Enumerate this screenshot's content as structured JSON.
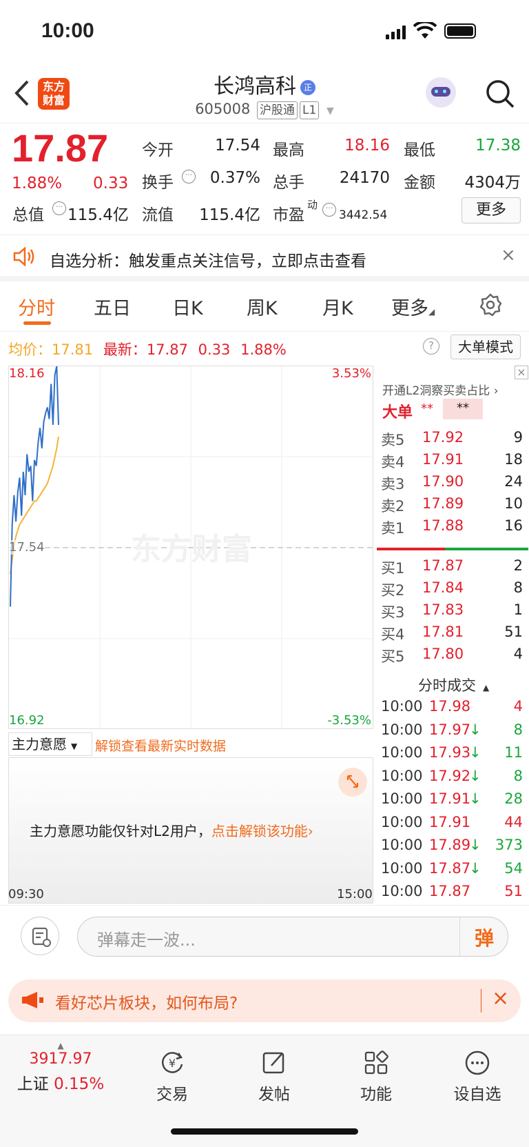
{
  "status_bar": {
    "time": "10:00"
  },
  "header": {
    "logo_line1": "东方",
    "logo_line2": "财富",
    "stock_name": "长鸿高科",
    "badge": "正",
    "code": "605008",
    "tag1": "沪股通",
    "tag2": "L1"
  },
  "quote": {
    "price": "17.87",
    "change_pct": "1.88%",
    "change": "0.33",
    "open_label": "今开",
    "open": "17.54",
    "high_label": "最高",
    "high": "18.16",
    "low_label": "最低",
    "low": "17.38",
    "turnover_label": "换手",
    "turnover": "0.37%",
    "volume_label": "总手",
    "volume": "24170",
    "amount_label": "金额",
    "amount": "4304万",
    "mktcap_label": "总值",
    "mktcap": "115.4亿",
    "float_label": "流值",
    "float": "115.4亿",
    "pe_label": "市盈",
    "pe_sup": "动",
    "pe": "3442.54",
    "more_button": "更多"
  },
  "notice": {
    "text": "自选分析：触发重点关注信号，立即点击查看"
  },
  "tabs": [
    "分时",
    "五日",
    "日K",
    "周K",
    "月K",
    "更多"
  ],
  "info_line": {
    "avg_label": "均价：",
    "avg": "17.81",
    "latest_label": "最新：",
    "latest": "17.87",
    "chg": "0.33",
    "pct": "1.88%",
    "mode_button": "大单模式"
  },
  "chart": {
    "y_top": "18.16",
    "y_mid": "17.54",
    "y_bottom": "16.92",
    "pct_top": "3.53%",
    "pct_bottom": "-3.53%",
    "x_start": "09:30",
    "x_end": "15:00",
    "watermark": "东方财富"
  },
  "chart_data": {
    "type": "line",
    "ylim": [
      16.92,
      18.16
    ],
    "reference": 17.54,
    "series": [
      {
        "values": [
          17.34,
          17.62,
          17.72,
          17.63,
          17.73,
          17.78,
          17.65,
          17.8,
          17.72,
          17.86,
          17.8,
          17.82,
          17.7,
          17.84,
          17.82,
          17.9,
          17.95,
          17.88,
          17.97,
          18.0,
          18.02,
          17.98,
          18.1,
          17.96,
          18.13,
          18.16,
          17.96
        ]
      },
      {
        "values": [
          17.45,
          17.5,
          17.55,
          17.58,
          17.6,
          17.62,
          17.63,
          17.64,
          17.65,
          17.66,
          17.67,
          17.68,
          17.69,
          17.7,
          17.7,
          17.71,
          17.72,
          17.73,
          17.74,
          17.75,
          17.76,
          17.78,
          17.8,
          17.82,
          17.85,
          17.88,
          17.92
        ]
      }
    ]
  },
  "main_force": {
    "dropdown": "主力意愿",
    "unlock_link": "解锁查看最新实时数据",
    "locked_text": "主力意愿功能仅针对L2用户，",
    "locked_link": "点击解锁该功能"
  },
  "order_book": {
    "l2_link": "开通L2洞察买卖占比",
    "big_label": "大单",
    "big_mask1": "**",
    "big_mask2": "**",
    "asks": [
      {
        "label": "卖5",
        "price": "17.92",
        "vol": "9"
      },
      {
        "label": "卖4",
        "price": "17.91",
        "vol": "18"
      },
      {
        "label": "卖3",
        "price": "17.90",
        "vol": "24"
      },
      {
        "label": "卖2",
        "price": "17.89",
        "vol": "10"
      },
      {
        "label": "卖1",
        "price": "17.88",
        "vol": "16"
      }
    ],
    "bids": [
      {
        "label": "买1",
        "price": "17.87",
        "vol": "2"
      },
      {
        "label": "买2",
        "price": "17.84",
        "vol": "8"
      },
      {
        "label": "买3",
        "price": "17.83",
        "vol": "1"
      },
      {
        "label": "买4",
        "price": "17.81",
        "vol": "51"
      },
      {
        "label": "买5",
        "price": "17.80",
        "vol": "4"
      }
    ]
  },
  "ticks": {
    "title": "分时成交",
    "rows": [
      {
        "time": "10:00",
        "price": "17.98",
        "arrow": "",
        "vol": "4"
      },
      {
        "time": "10:00",
        "price": "17.97",
        "arrow": "↓",
        "vol": "8"
      },
      {
        "time": "10:00",
        "price": "17.93",
        "arrow": "↓",
        "vol": "11"
      },
      {
        "time": "10:00",
        "price": "17.92",
        "arrow": "↓",
        "vol": "8"
      },
      {
        "time": "10:00",
        "price": "17.91",
        "arrow": "↓",
        "vol": "28"
      },
      {
        "time": "10:00",
        "price": "17.91",
        "arrow": "",
        "vol": "44"
      },
      {
        "time": "10:00",
        "price": "17.89",
        "arrow": "↓",
        "vol": "373"
      },
      {
        "time": "10:00",
        "price": "17.87",
        "arrow": "↓",
        "vol": "54"
      },
      {
        "time": "10:00",
        "price": "17.87",
        "arrow": "",
        "vol": "51"
      }
    ]
  },
  "danmu": {
    "placeholder": "弹幕走一波...",
    "send": "弹"
  },
  "ad": {
    "text": "看好芯片板块，如何布局?"
  },
  "bottom_nav": {
    "index_value": "3917.97",
    "index_name": "上证",
    "index_pct": "0.15%",
    "items": [
      "交易",
      "发帖",
      "功能",
      "设自选"
    ]
  },
  "colors": {
    "up": "#e3202c",
    "down": "#19a63c",
    "accent": "#f26b1d",
    "price_line": "#2f6fc9",
    "avg_line": "#f5b335"
  }
}
